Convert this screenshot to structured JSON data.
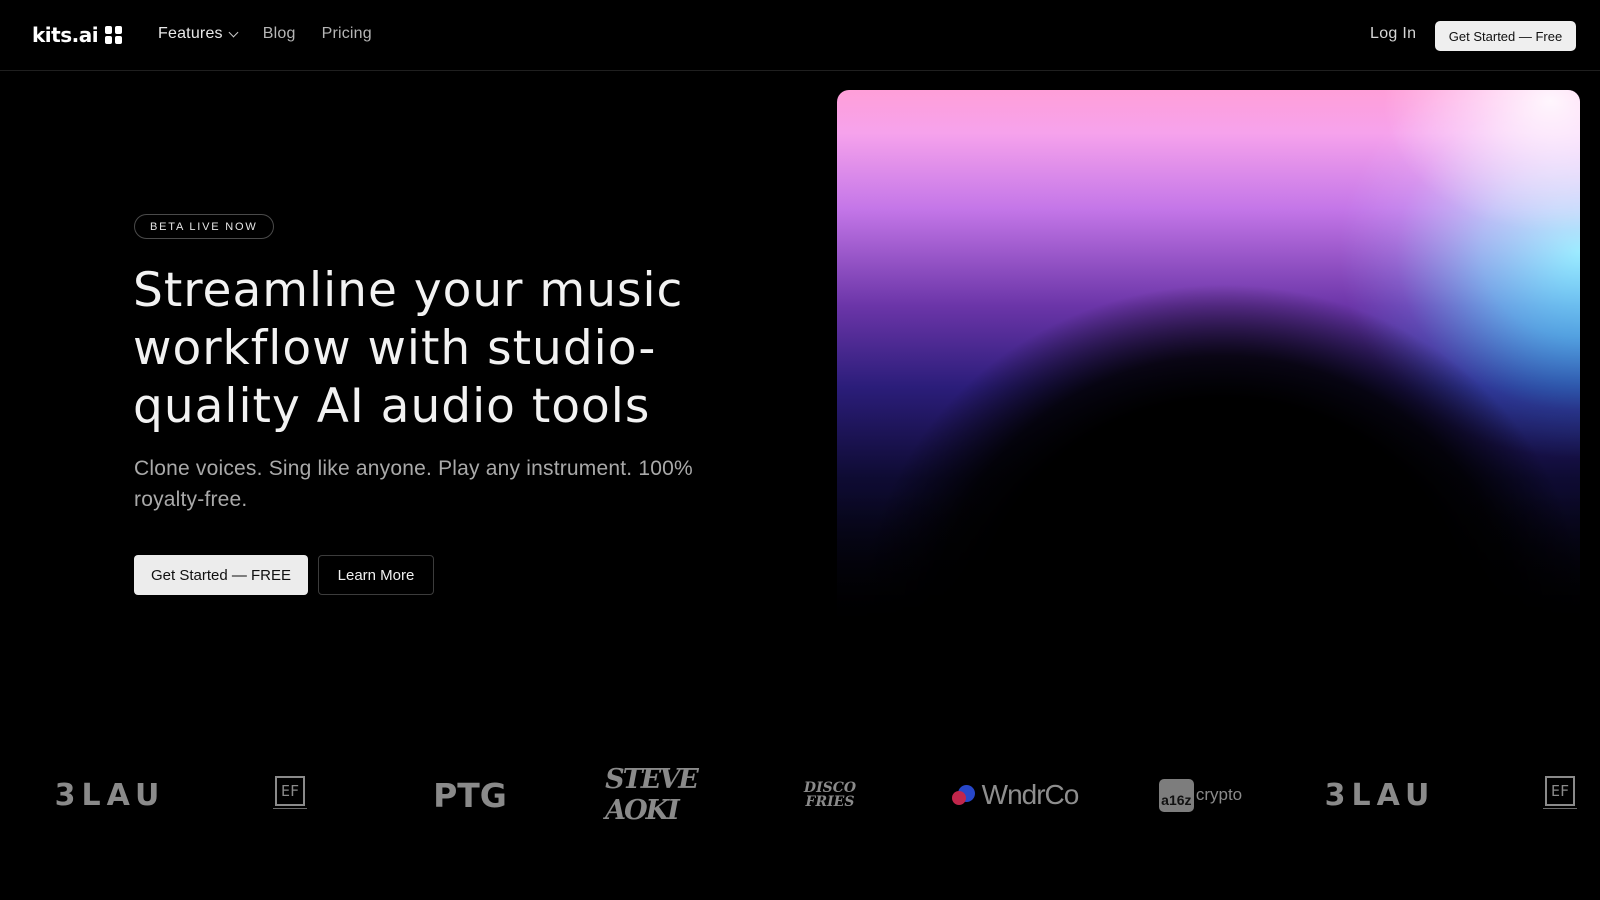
{
  "nav": {
    "logo_text": "kits.ai",
    "links": [
      {
        "label": "Features",
        "has_dropdown": true
      },
      {
        "label": "Blog"
      },
      {
        "label": "Pricing"
      }
    ],
    "login_label": "Log In",
    "cta_label": "Get Started — Free"
  },
  "hero": {
    "badge": "BETA LIVE NOW",
    "headline": "Streamline your music workflow with studio-quality AI audio tools",
    "subheadline": "Clone voices. Sing like anyone. Play any instrument. 100% royalty-free.",
    "primary_button": "Get Started — FREE",
    "secondary_button": "Learn More"
  },
  "logos": {
    "items": [
      {
        "name": "3LAU",
        "text": "3LAU"
      },
      {
        "name": "EF",
        "text": "EF"
      },
      {
        "name": "PTG",
        "text": "PTG"
      },
      {
        "name": "Steve Aoki",
        "text": "STEVE AOKI"
      },
      {
        "name": "Disco Fries",
        "text": "DISCO FRIES"
      },
      {
        "name": "WndrCo",
        "text": "WndrCo"
      },
      {
        "name": "a16z crypto",
        "text_box": "a16z",
        "text": "crypto"
      },
      {
        "name": "3LAU",
        "text": "3LAU"
      },
      {
        "name": "EF",
        "text": "EF"
      }
    ]
  },
  "colors": {
    "background": "#000000",
    "cta_bg": "#efefef",
    "text_muted": "#a9a9a9",
    "gradient_pink": "#ff9fd8",
    "gradient_cyan": "#00e1ff",
    "gradient_violet": "#6b35a8"
  }
}
